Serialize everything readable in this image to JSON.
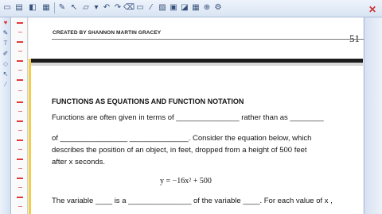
{
  "app": {
    "close_icon": "close-icon"
  },
  "toolbar": {
    "icons": [
      {
        "name": "new-page-icon",
        "glyph": "▭"
      },
      {
        "name": "folder-icon",
        "glyph": "▤"
      },
      {
        "name": "save-icon",
        "glyph": "◧"
      },
      {
        "name": "grid-icon",
        "glyph": "▦"
      },
      {
        "name": "pen-icon",
        "glyph": "✎"
      },
      {
        "name": "pointer-icon",
        "glyph": "↖"
      },
      {
        "name": "highlighter-icon",
        "glyph": "▱"
      },
      {
        "name": "color-dropdown-icon",
        "glyph": "▾"
      },
      {
        "name": "undo-icon",
        "glyph": "↶"
      },
      {
        "name": "redo-icon",
        "glyph": "↷"
      },
      {
        "name": "eraser-icon",
        "glyph": "⌫"
      },
      {
        "name": "shapes-icon",
        "glyph": "▭"
      },
      {
        "name": "line-icon",
        "glyph": "⁄"
      },
      {
        "name": "image-icon",
        "glyph": "▨"
      },
      {
        "name": "screen-icon",
        "glyph": "▣"
      },
      {
        "name": "capture-icon",
        "glyph": "◪"
      },
      {
        "name": "table-icon",
        "glyph": "▦"
      },
      {
        "name": "zoom-icon",
        "glyph": "⊕"
      },
      {
        "name": "options-icon",
        "glyph": "⚙"
      }
    ]
  },
  "document": {
    "header": "CREATED BY SHANNON MARTIN GRACEY",
    "page_number": "51",
    "title": "FUNCTIONS AS EQUATIONS AND FUNCTION NOTATION",
    "lines": [
      "Functions are often given in terms of _______________ rather than as ________",
      "of ________________ ______________.  Consider the equation below, which",
      "describes the position of an object, in feet, dropped from a height of 500 feet",
      "after  x  seconds.",
      "The variable ____ is a _______________ of the variable ____.  For each value of  x ,"
    ],
    "equation": "y = −16x² + 500"
  }
}
